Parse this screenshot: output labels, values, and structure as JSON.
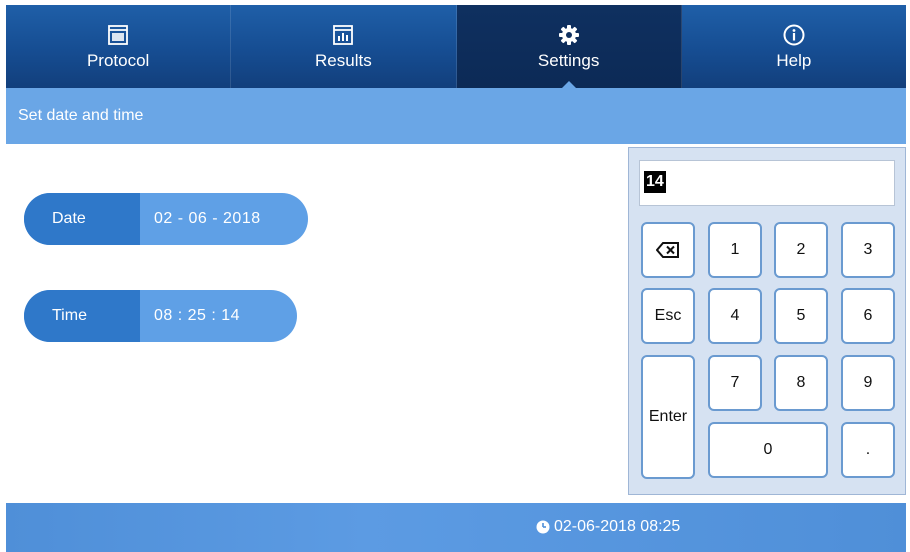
{
  "nav": {
    "tabs": [
      {
        "label": "Protocol",
        "icon": "window-icon"
      },
      {
        "label": "Results",
        "icon": "bar-chart-icon"
      },
      {
        "label": "Settings",
        "icon": "gear-icon",
        "active": true
      },
      {
        "label": "Help",
        "icon": "info-icon"
      }
    ]
  },
  "title": "Set date and time",
  "date": {
    "label": "Date",
    "value": "02 - 06 - 2018"
  },
  "time": {
    "label": "Time",
    "value": "08 : 25 : 14"
  },
  "keypad": {
    "display": "14",
    "keys": {
      "backspace": "⌫",
      "k1": "1",
      "k2": "2",
      "k3": "3",
      "esc": "Esc",
      "k4": "4",
      "k5": "5",
      "k6": "6",
      "enter": "Enter",
      "k7": "7",
      "k8": "8",
      "k9": "9",
      "k0": "0",
      "dot": "."
    }
  },
  "status": {
    "datetime": "02-06-2018 08:25"
  },
  "colors": {
    "nav": "#164d92",
    "accent": "#6aa6e6",
    "field_label": "#2f78c9",
    "field_value": "#5fa0e6"
  }
}
